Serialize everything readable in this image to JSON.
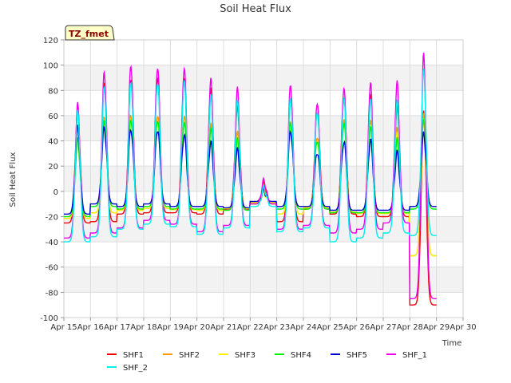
{
  "chart_data": {
    "type": "line",
    "title": "Soil Heat Flux",
    "xlabel": "Time",
    "ylabel": "Soil Heat Flux",
    "badge": "TZ_fmet",
    "x_range": [
      "Apr 15",
      "Apr 30"
    ],
    "ylim": [
      -100,
      120
    ],
    "x_ticks": [
      "Apr 15",
      "Apr 16",
      "Apr 17",
      "Apr 18",
      "Apr 19",
      "Apr 20",
      "Apr 21",
      "Apr 22",
      "Apr 23",
      "Apr 24",
      "Apr 25",
      "Apr 26",
      "Apr 27",
      "Apr 28",
      "Apr 29",
      "Apr 30"
    ],
    "y_ticks": [
      -100,
      -80,
      -60,
      -40,
      -20,
      0,
      20,
      40,
      60,
      80,
      100,
      120
    ],
    "grid": true,
    "legend_position": "bottom",
    "data_x_range": [
      "Apr 15",
      "Apr 29"
    ],
    "series": [
      {
        "name": "SHF1",
        "color": "#ee0000"
      },
      {
        "name": "SHF2",
        "color": "#ff9900"
      },
      {
        "name": "SHF3",
        "color": "#ffee00"
      },
      {
        "name": "SHF4",
        "color": "#00ee00"
      },
      {
        "name": "SHF5",
        "color": "#0000cc"
      },
      {
        "name": "SHF_1",
        "color": "#ee00ee"
      },
      {
        "name": "SHF_2",
        "color": "#00eeee"
      }
    ],
    "daily_profile": {
      "days": [
        "Apr 15",
        "Apr 16",
        "Apr 17",
        "Apr 18",
        "Apr 19",
        "Apr 20",
        "Apr 21",
        "Apr 22",
        "Apr 23",
        "Apr 24",
        "Apr 25",
        "Apr 26",
        "Apr 27",
        "Apr 28"
      ],
      "SHF1_min": [
        -25,
        -24,
        -18,
        -17,
        -17,
        -18,
        -14,
        -10,
        -24,
        -14,
        -18,
        -20,
        -20,
        -90
      ],
      "SHF1_max": [
        65,
        85,
        90,
        92,
        90,
        80,
        65,
        5,
        75,
        65,
        75,
        75,
        65,
        62
      ],
      "SHF2_max": [
        48,
        58,
        62,
        62,
        60,
        52,
        45,
        3,
        56,
        45,
        58,
        55,
        48,
        60
      ],
      "SHF4_max": [
        40,
        55,
        58,
        58,
        55,
        48,
        40,
        2,
        55,
        42,
        55,
        50,
        40,
        55
      ],
      "SHF5_min": [
        -18,
        -10,
        -12,
        -10,
        -12,
        -12,
        -13,
        -8,
        -12,
        -12,
        -15,
        -15,
        -15,
        -12
      ],
      "SHF5_max": [
        50,
        50,
        50,
        50,
        45,
        38,
        32,
        0,
        48,
        32,
        40,
        40,
        30,
        45
      ],
      "SHF_1_min": [
        -37,
        -33,
        -29,
        -23,
        -26,
        -32,
        -27,
        -10,
        -30,
        -27,
        -33,
        -30,
        -25,
        -85
      ],
      "SHF_1_max": [
        68,
        94,
        101,
        100,
        98,
        88,
        80,
        8,
        85,
        72,
        83,
        85,
        85,
        108
      ],
      "SHF_2_min": [
        -40,
        -36,
        -30,
        -26,
        -28,
        -34,
        -29,
        -12,
        -32,
        -29,
        -40,
        -37,
        -33,
        -35
      ],
      "SHF_2_max": [
        62,
        82,
        88,
        88,
        88,
        75,
        70,
        2,
        75,
        65,
        75,
        72,
        70,
        95
      ]
    }
  }
}
